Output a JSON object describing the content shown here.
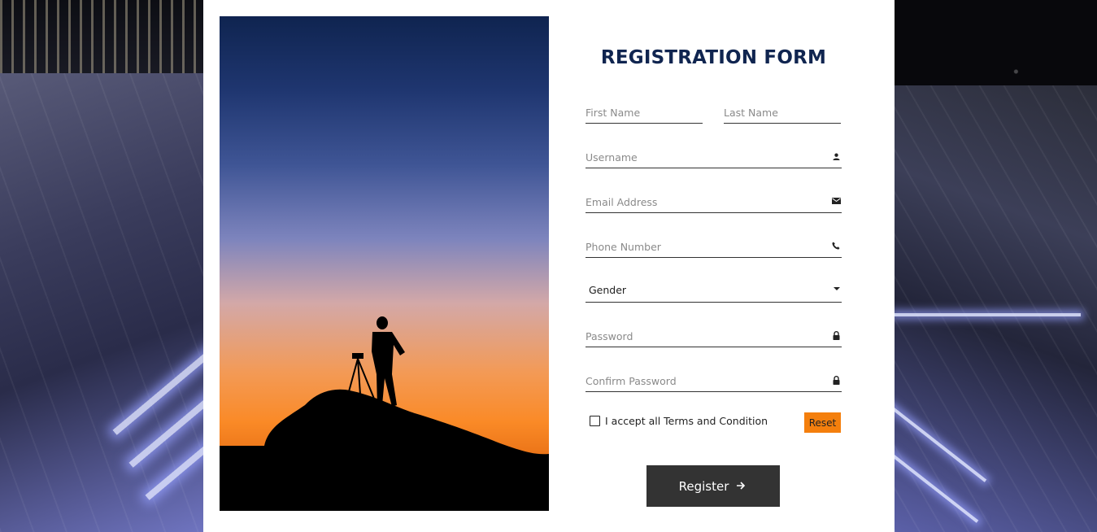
{
  "form": {
    "title": "REGISTRATION FORM",
    "first_name_placeholder": "First Name",
    "last_name_placeholder": "Last Name",
    "username_placeholder": "Username",
    "email_placeholder": "Email Address",
    "phone_placeholder": "Phone Number",
    "gender_value": "Gender",
    "password_placeholder": "Password",
    "confirm_password_placeholder": "Confirm Password",
    "terms_label": "I accept all Terms and Condition",
    "terms_checked": false,
    "reset_label": "Reset",
    "register_label": "Register"
  },
  "icons": {
    "username": "user-icon",
    "email": "envelope-icon",
    "phone": "phone-icon",
    "gender": "caret-down-icon",
    "password": "lock-icon",
    "confirm_password": "lock-icon",
    "register": "arrow-right-icon"
  },
  "colors": {
    "title": "#102550",
    "reset_button": "#f47f0d",
    "register_button": "#333333",
    "card": "#ffffff"
  }
}
